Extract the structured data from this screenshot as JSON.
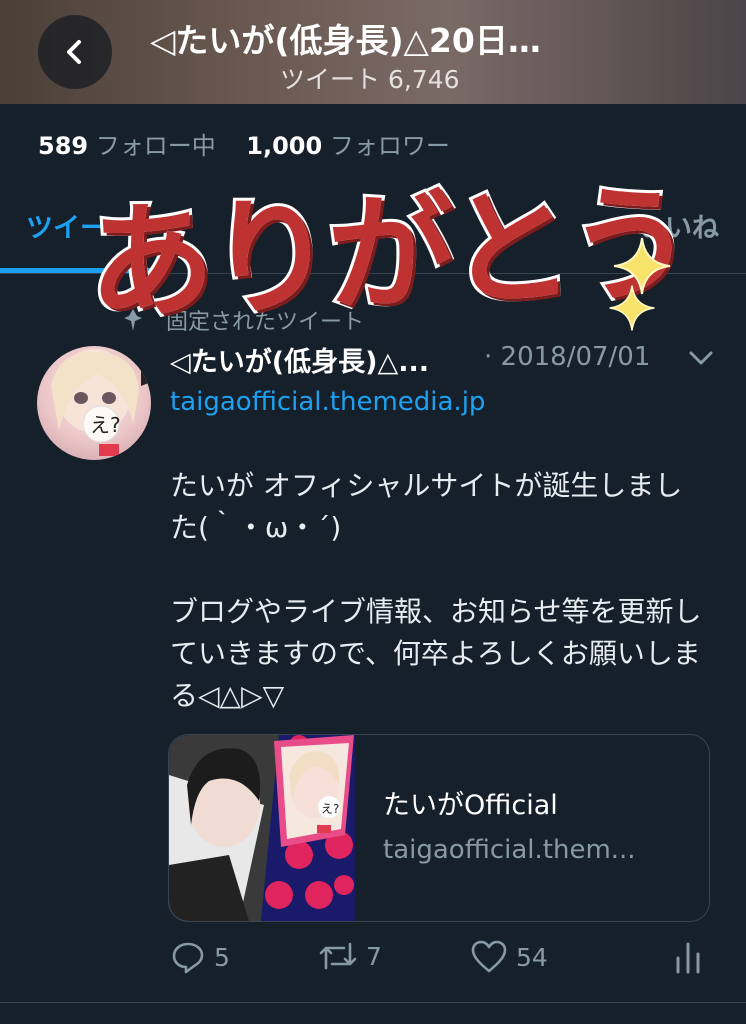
{
  "header": {
    "title": "◁たいが(低身長)△20日…",
    "tweet_count": "ツイート 6,746"
  },
  "stats": {
    "following_count": "589",
    "following_label": "フォロー中",
    "followers_count": "1,000",
    "followers_label": "フォロワー"
  },
  "tabs": {
    "tweets": "ツイー",
    "likes": "いいね"
  },
  "overlay": {
    "text": "ありがとう",
    "color": "#bf3232"
  },
  "tweet": {
    "pinned_label": "固定されたツイート",
    "author": "◁たいが(低身長)△...",
    "date": "· 2018/07/01",
    "link": "taigaofficial.themedia.jp",
    "text": "たいが オフィシャルサイトが誕生しました(｀・ω・´)\n\nブログやライブ情報、お知らせ等を更新していきますので、何卒よろしくお願いしまる◁△▷▽",
    "card": {
      "title": "たいがOfficial",
      "domain": "taigaofficial.them..."
    },
    "actions": {
      "replies": "5",
      "retweets": "7",
      "likes": "54"
    }
  },
  "colors": {
    "accent": "#1da1f2",
    "background": "#15202b",
    "muted": "#8899a6"
  }
}
